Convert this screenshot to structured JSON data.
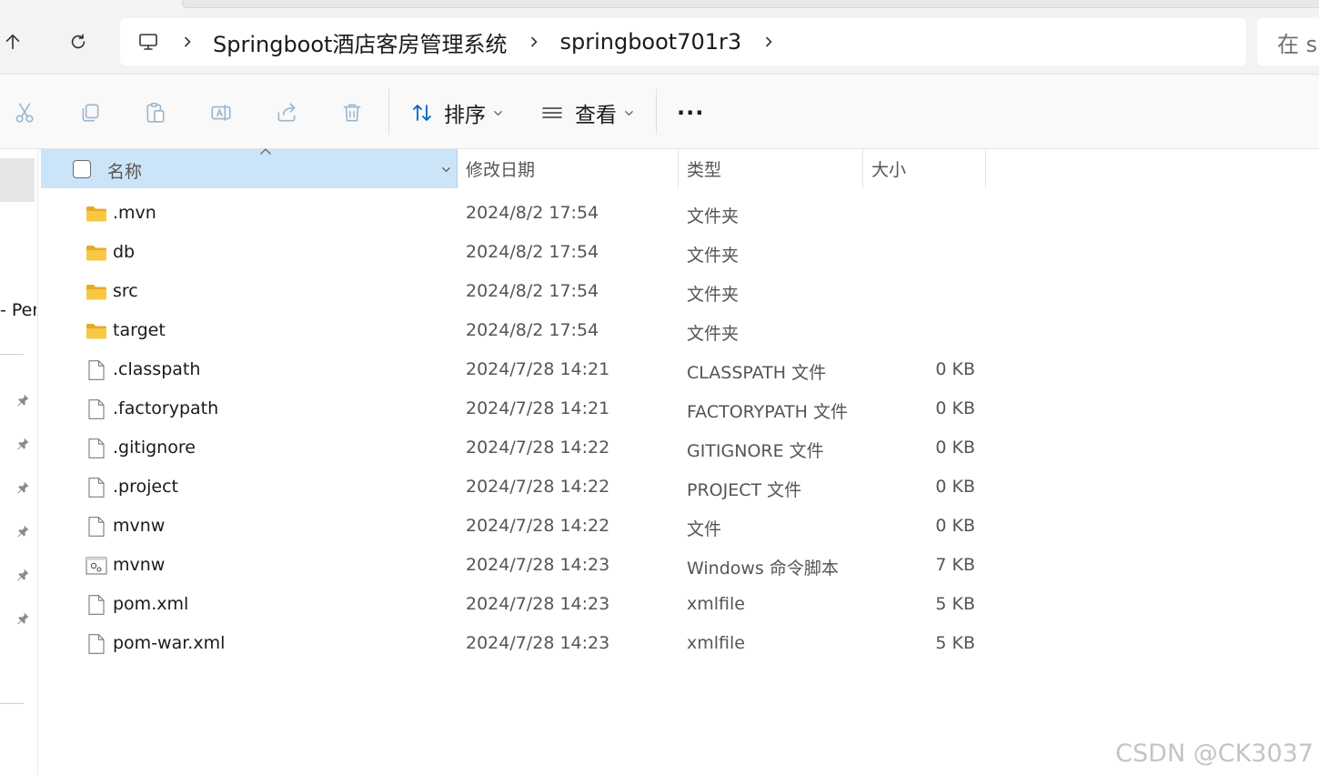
{
  "address": {
    "breadcrumbs": [
      "Springboot酒店客房管理系统",
      "springboot701r3"
    ],
    "search_placeholder": "在 s"
  },
  "toolbar": {
    "sort_label": "排序",
    "view_label": "查看",
    "more_label": "···"
  },
  "nav": {
    "truncated_item": "- Pers"
  },
  "columns": {
    "name": "名称",
    "date": "修改日期",
    "type": "类型",
    "size": "大小"
  },
  "files": [
    {
      "name": ".mvn",
      "date": "2024/8/2 17:54",
      "type": "文件夹",
      "size": "",
      "icon": "folder-icon"
    },
    {
      "name": "db",
      "date": "2024/8/2 17:54",
      "type": "文件夹",
      "size": "",
      "icon": "folder-icon"
    },
    {
      "name": "src",
      "date": "2024/8/2 17:54",
      "type": "文件夹",
      "size": "",
      "icon": "folder-icon"
    },
    {
      "name": "target",
      "date": "2024/8/2 17:54",
      "type": "文件夹",
      "size": "",
      "icon": "folder-icon"
    },
    {
      "name": ".classpath",
      "date": "2024/7/28 14:21",
      "type": "CLASSPATH 文件",
      "size": "0 KB",
      "icon": "file-icon"
    },
    {
      "name": ".factorypath",
      "date": "2024/7/28 14:21",
      "type": "FACTORYPATH 文件",
      "size": "0 KB",
      "icon": "file-icon"
    },
    {
      "name": ".gitignore",
      "date": "2024/7/28 14:22",
      "type": "GITIGNORE 文件",
      "size": "0 KB",
      "icon": "file-icon"
    },
    {
      "name": ".project",
      "date": "2024/7/28 14:22",
      "type": "PROJECT 文件",
      "size": "0 KB",
      "icon": "file-icon"
    },
    {
      "name": "mvnw",
      "date": "2024/7/28 14:22",
      "type": "文件",
      "size": "0 KB",
      "icon": "file-icon"
    },
    {
      "name": "mvnw",
      "date": "2024/7/28 14:23",
      "type": "Windows 命令脚本",
      "size": "7 KB",
      "icon": "script-icon"
    },
    {
      "name": "pom.xml",
      "date": "2024/7/28 14:23",
      "type": "xmlfile",
      "size": "5 KB",
      "icon": "file-icon"
    },
    {
      "name": "pom-war.xml",
      "date": "2024/7/28 14:23",
      "type": "xmlfile",
      "size": "5 KB",
      "icon": "file-icon"
    }
  ],
  "colors": {
    "header_selected": "#cce4f7",
    "folder": "#f8c844",
    "accent": "#0067c0"
  },
  "watermark": "CSDN @CK3037"
}
